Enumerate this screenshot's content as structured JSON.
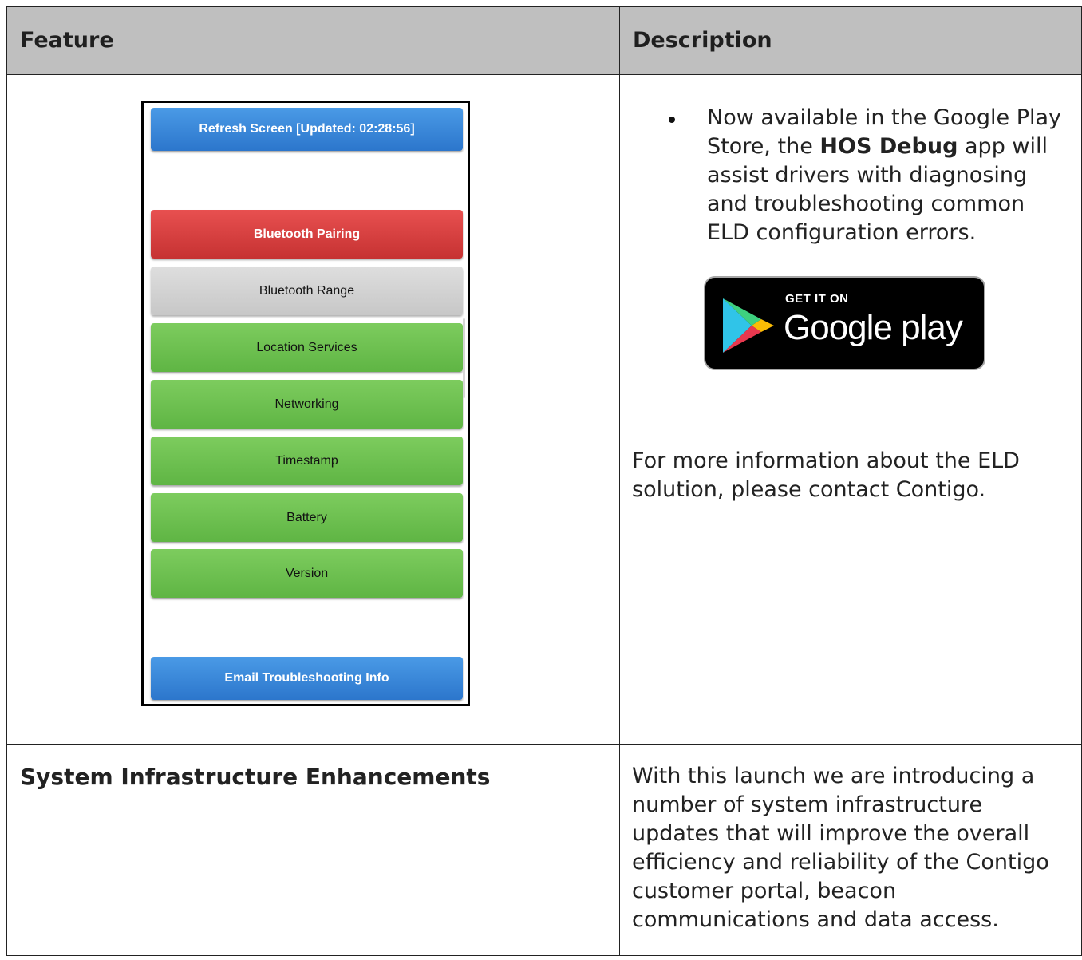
{
  "table": {
    "header": {
      "feature": "Feature",
      "description": "Description"
    }
  },
  "debug_app": {
    "refresh_label": "Refresh Screen [Updated: 02:28:56]",
    "buttons": [
      {
        "label": "Bluetooth Pairing",
        "status": "error",
        "color": "#d94040"
      },
      {
        "label": "Bluetooth Range",
        "status": "unknown",
        "color": "#cfcfcf"
      },
      {
        "label": "Location Services",
        "status": "ok",
        "color": "#6cc04f"
      },
      {
        "label": "Networking",
        "status": "ok",
        "color": "#6cc04f"
      },
      {
        "label": "Timestamp",
        "status": "ok",
        "color": "#6cc04f"
      },
      {
        "label": "Battery",
        "status": "ok",
        "color": "#6cc04f"
      },
      {
        "label": "Version",
        "status": "ok",
        "color": "#6cc04f"
      }
    ],
    "email_label": "Email Troubleshooting Info"
  },
  "description1": {
    "bullet_before": "Now available in the Google Play Store, the ",
    "bullet_bold": "HOS Debug",
    "bullet_after": " app will assist drivers with diagnosing and troubleshooting common ELD configuration errors.",
    "badge": {
      "get_it_on": "GET IT ON",
      "brand": "Google play",
      "icon": "google-play-logo"
    },
    "more_info": "For more information about the ELD solution, please contact Contigo."
  },
  "row2": {
    "feature": "System Infrastructure Enhancements",
    "description": "With this launch we are introducing a number of system infrastructure updates that will improve the overall efficiency and reliability of the Contigo customer portal, beacon communications and data access."
  }
}
